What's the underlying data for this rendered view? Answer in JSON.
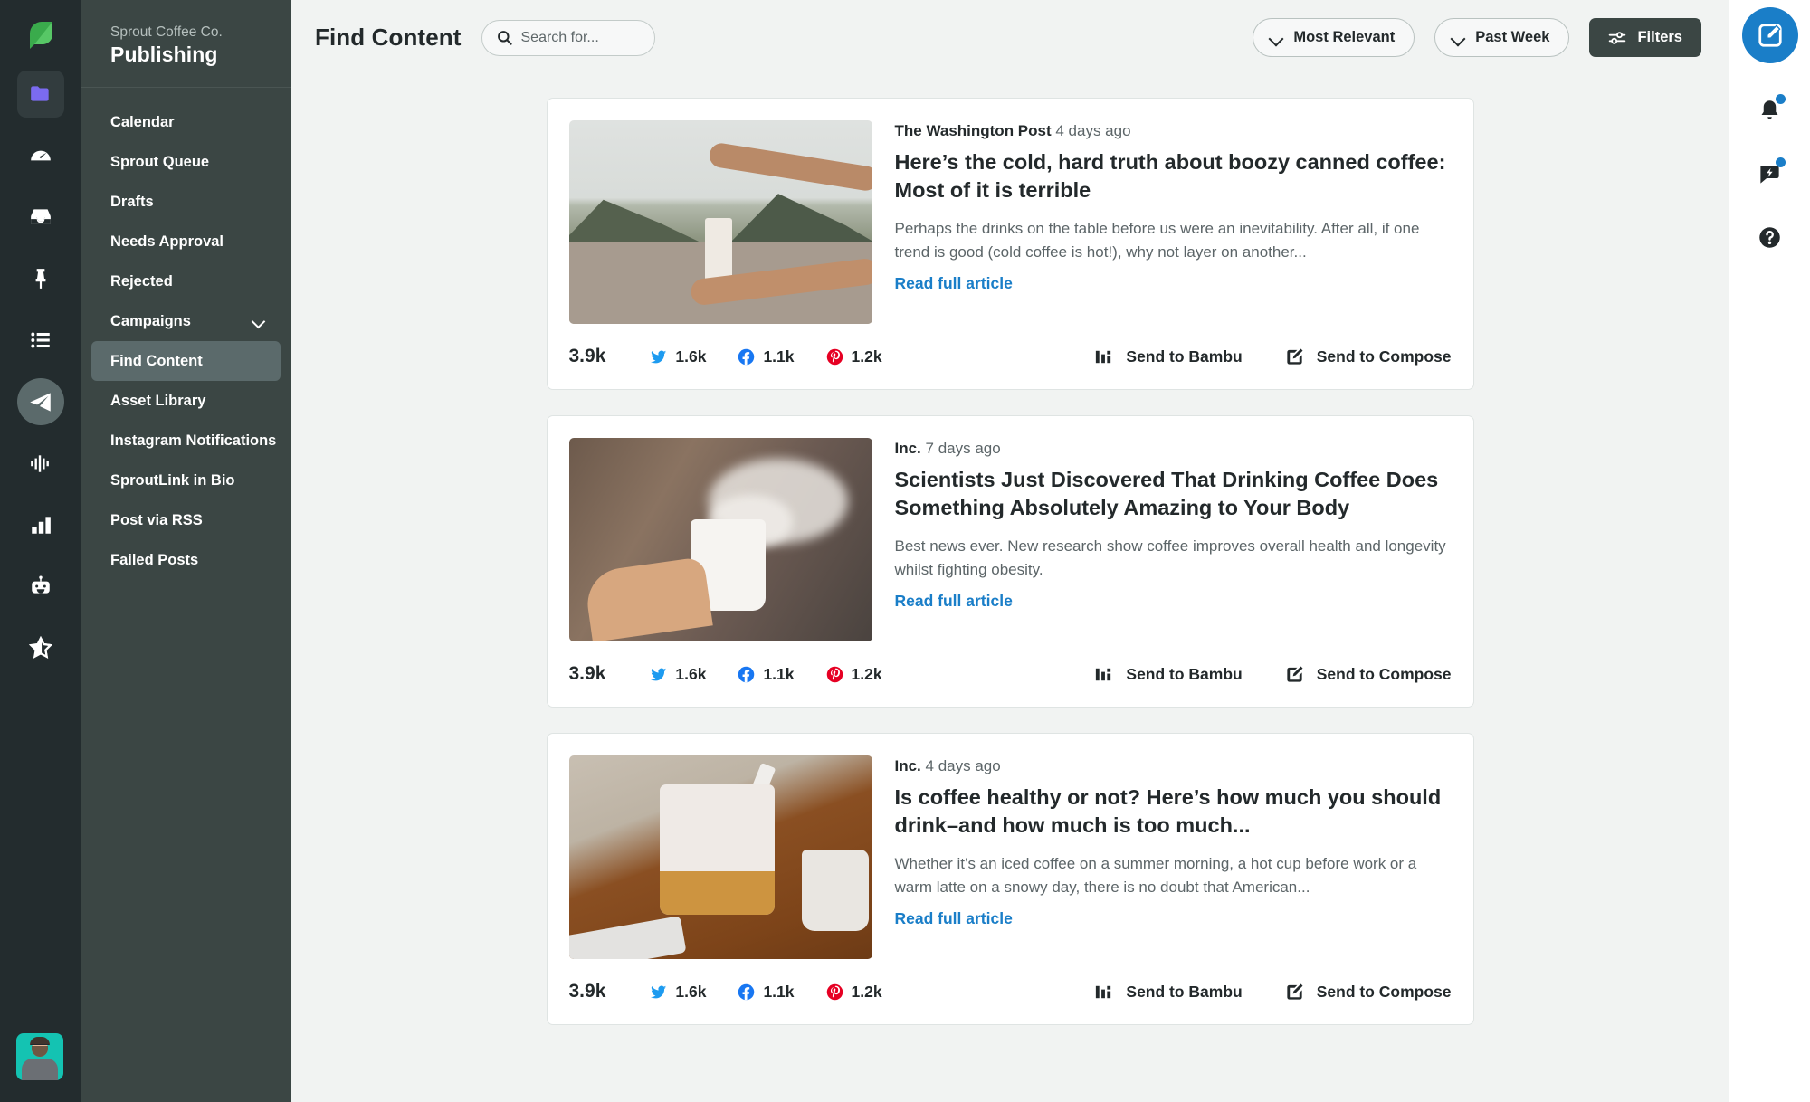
{
  "rail": {
    "logo": "sprout-leaf-logo",
    "items": [
      {
        "name": "folder-icon",
        "active": true
      },
      {
        "name": "speedometer-icon",
        "active": false
      },
      {
        "name": "inbox-icon",
        "active": false
      },
      {
        "name": "pin-icon",
        "active": false
      },
      {
        "name": "list-icon",
        "active": false
      },
      {
        "name": "paper-plane-icon",
        "active": true
      },
      {
        "name": "audio-wave-icon",
        "active": false
      },
      {
        "name": "bar-chart-icon",
        "active": false
      },
      {
        "name": "robot-icon",
        "active": false
      },
      {
        "name": "star-icon",
        "active": false
      }
    ],
    "avatar_label": "user-avatar"
  },
  "sidebar": {
    "org": "Sprout Coffee Co.",
    "title": "Publishing",
    "items": [
      {
        "label": "Calendar",
        "active": false,
        "expandable": false
      },
      {
        "label": "Sprout Queue",
        "active": false,
        "expandable": false
      },
      {
        "label": "Drafts",
        "active": false,
        "expandable": false
      },
      {
        "label": "Needs Approval",
        "active": false,
        "expandable": false
      },
      {
        "label": "Rejected",
        "active": false,
        "expandable": false
      },
      {
        "label": "Campaigns",
        "active": false,
        "expandable": true
      },
      {
        "label": "Find Content",
        "active": true,
        "expandable": false
      },
      {
        "label": "Asset Library",
        "active": false,
        "expandable": false
      },
      {
        "label": "Instagram Notifications",
        "active": false,
        "expandable": false
      },
      {
        "label": "SproutLink in Bio",
        "active": false,
        "expandable": false
      },
      {
        "label": "Post via RSS",
        "active": false,
        "expandable": false
      },
      {
        "label": "Failed Posts",
        "active": false,
        "expandable": false
      }
    ]
  },
  "topbar": {
    "page_title": "Find Content",
    "search_placeholder": "Search for...",
    "search_value": "",
    "sort_label": "Most Relevant",
    "date_label": "Past Week",
    "filters_label": "Filters"
  },
  "cards": [
    {
      "source": "The Washington Post",
      "time": "4 days ago",
      "headline": "Here’s the cold, hard truth about boozy canned coffee: Most of it is terrible",
      "description": "Perhaps the drinks on the table before us were an inevitability. After all, if one trend is good (cold coffee is hot!), why not layer on another...",
      "read_link": "Read full article",
      "total": "3.9k",
      "stats": [
        {
          "network": "twitter",
          "value": "1.6k"
        },
        {
          "network": "facebook",
          "value": "1.1k"
        },
        {
          "network": "pinterest",
          "value": "1.2k"
        }
      ],
      "actions": [
        {
          "label": "Send to Bambu",
          "icon": "bambu-bars-icon"
        },
        {
          "label": "Send to Compose",
          "icon": "compose-pencil-icon"
        }
      ],
      "image": "hands-opening-can-in-mountains"
    },
    {
      "source": "Inc.",
      "time": "7 days ago",
      "headline": "Scientists Just Discovered That Drinking Coffee Does Something Absolutely Amazing to Your Body",
      "description": "Best news ever. New research show coffee improves overall health and longevity whilst fighting obesity.",
      "read_link": "Read full article",
      "total": "3.9k",
      "stats": [
        {
          "network": "twitter",
          "value": "1.6k"
        },
        {
          "network": "facebook",
          "value": "1.1k"
        },
        {
          "network": "pinterest",
          "value": "1.2k"
        }
      ],
      "actions": [
        {
          "label": "Send to Bambu",
          "icon": "bambu-bars-icon"
        },
        {
          "label": "Send to Compose",
          "icon": "compose-pencil-icon"
        }
      ],
      "image": "hand-holding-steaming-coffee-mug"
    },
    {
      "source": "Inc.",
      "time": "4 days ago",
      "headline": "Is coffee healthy or not? Here’s how much you should drink–and how much is too much...",
      "description": "Whether it’s an iced coffee on a summer morning, a hot cup before work or a warm latte on a snowy day, there is no doubt that American...",
      "read_link": "Read full article",
      "total": "3.9k",
      "stats": [
        {
          "network": "twitter",
          "value": "1.6k"
        },
        {
          "network": "facebook",
          "value": "1.1k"
        },
        {
          "network": "pinterest",
          "value": "1.2k"
        }
      ],
      "actions": [
        {
          "label": "Send to Bambu",
          "icon": "bambu-bars-icon"
        },
        {
          "label": "Send to Compose",
          "icon": "compose-pencil-icon"
        }
      ],
      "image": "latte-glass-on-wooden-board"
    }
  ],
  "right_rail": {
    "compose": {
      "name": "compose-button"
    },
    "items": [
      {
        "name": "bell-icon",
        "badge": true
      },
      {
        "name": "announcement-icon",
        "badge": true
      },
      {
        "name": "help-icon",
        "badge": false
      }
    ]
  },
  "colors": {
    "rail_bg": "#232c2e",
    "nav_bg": "#3b4644",
    "nav_active": "#5b6a6b",
    "main_bg": "#f1f3f2",
    "card_bg": "#ffffff",
    "link_blue": "#1a7ec8",
    "text_dark": "#23292b",
    "text_muted": "#5c6568",
    "twitter": "#1d9bf0",
    "facebook": "#1877f2",
    "pinterest": "#e60023",
    "avatar_bg": "#14c3b2"
  }
}
